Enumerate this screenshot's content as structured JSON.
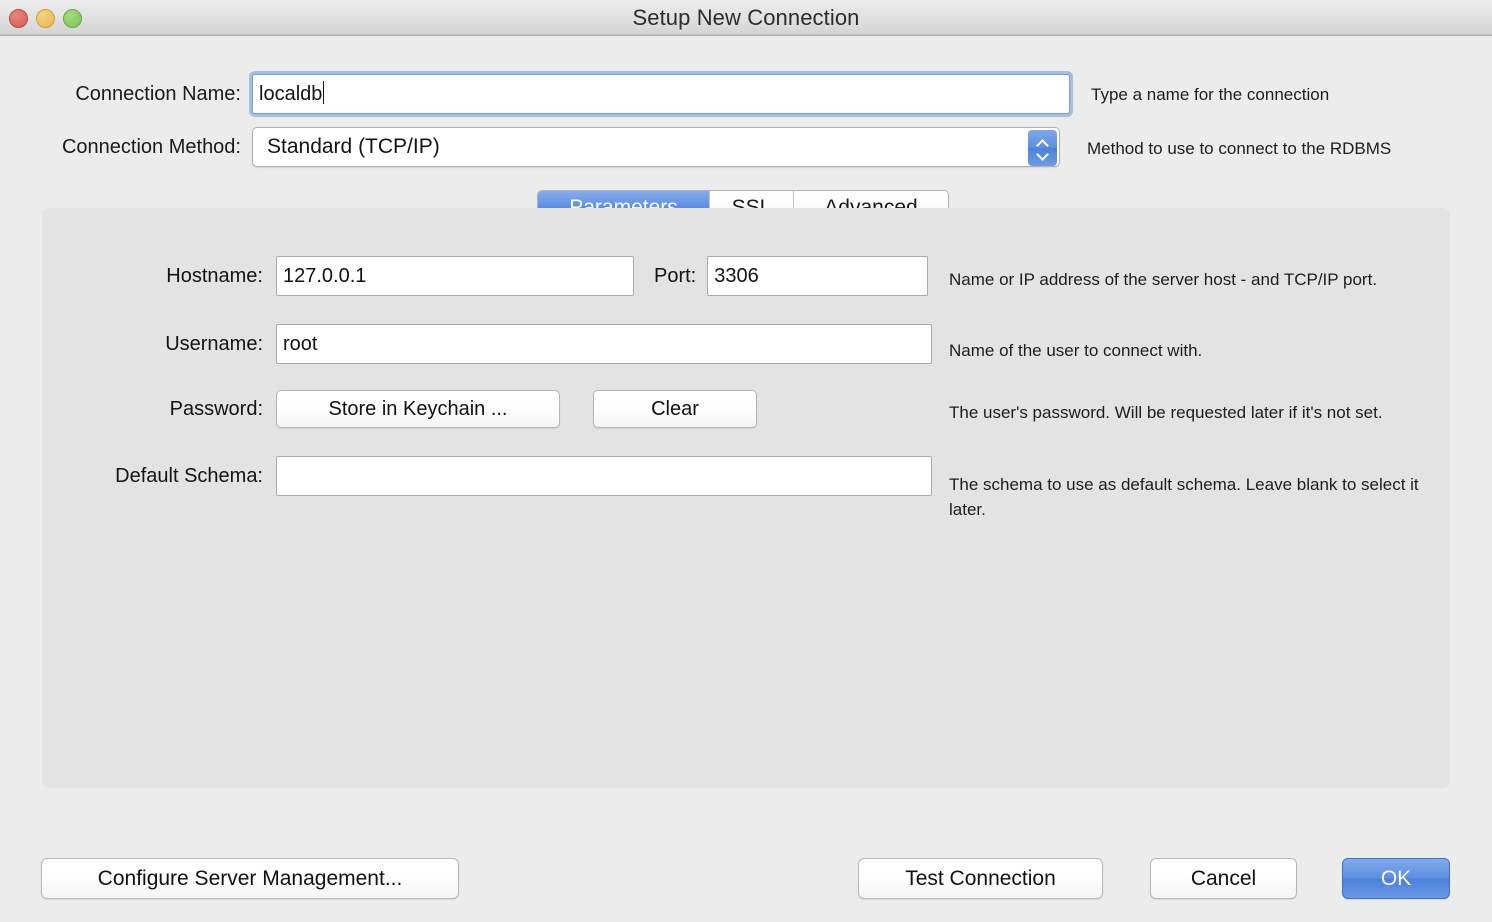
{
  "window": {
    "title": "Setup New Connection",
    "traffic_lights": [
      "close-button",
      "minimize-button",
      "zoom-button"
    ]
  },
  "form": {
    "connection_name": {
      "label": "Connection Name:",
      "value": "localdb",
      "placeholder": "",
      "hint": "Type a name for the connection",
      "focused": true
    },
    "connection_method": {
      "label": "Connection Method:",
      "value": "Standard (TCP/IP)",
      "hint": "Method to use to connect to the RDBMS",
      "options": [
        "Standard (TCP/IP)"
      ]
    }
  },
  "tabs": [
    {
      "label": "Parameters",
      "active": true
    },
    {
      "label": "SSL",
      "active": false
    },
    {
      "label": "Advanced",
      "active": false
    }
  ],
  "parameters": {
    "hostname": {
      "label": "Hostname:",
      "value": "127.0.0.1",
      "placeholder": "",
      "hint": "Name or IP address of the server host - and TCP/IP port."
    },
    "port": {
      "label": "Port:",
      "value": "3306",
      "placeholder": ""
    },
    "username": {
      "label": "Username:",
      "value": "root",
      "placeholder": "",
      "hint": "Name of the user to connect with."
    },
    "password": {
      "label": "Password:",
      "store_button": "Store in Keychain ...",
      "clear_button": "Clear",
      "hint": "The user's password. Will be requested later if it's not set."
    },
    "default_schema": {
      "label": "Default Schema:",
      "value": "",
      "placeholder": "",
      "hint": "The schema to use as default schema. Leave blank to select it later."
    }
  },
  "footer": {
    "configure": "Configure Server Management...",
    "test": "Test Connection",
    "cancel": "Cancel",
    "ok": "OK"
  },
  "colors": {
    "accent_blue": "#5e8ee1",
    "window_bg": "#ececec",
    "panel_bg": "#e3e3e3",
    "focus_ring": "#6e98d7"
  }
}
